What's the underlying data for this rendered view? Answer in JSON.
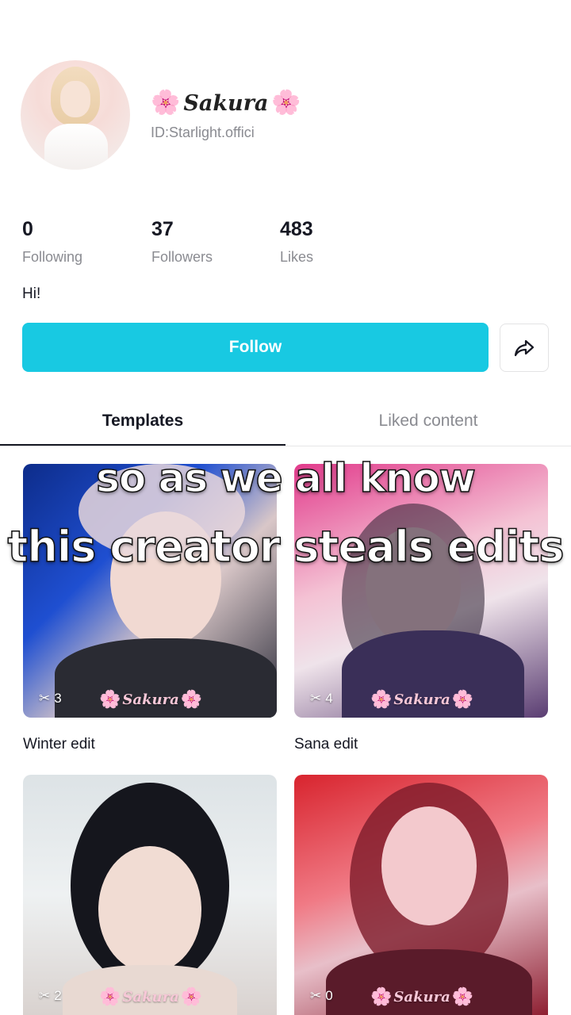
{
  "profile": {
    "name": "Sakura",
    "flower": "🌸",
    "id_text": "ID:Starlight.offici",
    "bio": "Hi!"
  },
  "stats": [
    {
      "value": "0",
      "label": "Following"
    },
    {
      "value": "37",
      "label": "Followers"
    },
    {
      "value": "483",
      "label": "Likes"
    }
  ],
  "actions": {
    "follow_label": "Follow",
    "follow_color": "#18c9e2",
    "share_icon": "share-icon"
  },
  "tabs": [
    {
      "label": "Templates",
      "active": true
    },
    {
      "label": "Liked content",
      "active": false
    }
  ],
  "templates": [
    {
      "title": "Winter edit",
      "uses": "3",
      "watermark": "Sakura"
    },
    {
      "title": "Sana edit",
      "uses": "4",
      "watermark": "Sakura"
    },
    {
      "title": "",
      "uses": "2",
      "watermark": "Sakura"
    },
    {
      "title": "",
      "uses": "0",
      "watermark": "Sakura"
    }
  ],
  "caption": {
    "line1": "so as we all know",
    "line2": "this creator steals edits"
  }
}
